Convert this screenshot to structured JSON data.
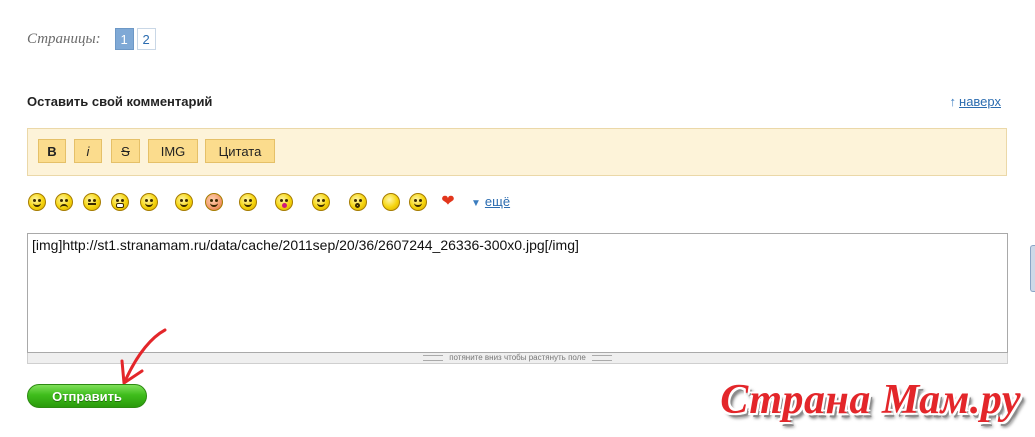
{
  "pager": {
    "label": "Страницы:",
    "pages": [
      "1",
      "2"
    ],
    "current": "1"
  },
  "comment": {
    "title": "Оставить свой комментарий",
    "to_top_label": "наверх"
  },
  "toolbar": {
    "bold": "B",
    "italic": "i",
    "strike": "S",
    "img": "IMG",
    "quote": "Цитата"
  },
  "smiles": {
    "icons": [
      "smile-icon",
      "sad-icon",
      "confused-icon",
      "grin-icon",
      "thumbs-up-icon",
      "wink-icon",
      "blush-icon",
      "girl-icon",
      "kiss-icon",
      "dance-icon",
      "surprised-icon",
      "plain-smiley-icon",
      "lollipop-icon",
      "heart-icon"
    ],
    "more_label": "ещё"
  },
  "editor": {
    "value": "[img]http://st1.stranamam.ru/data/cache/2011sep/20/36/2607244_26336-300x0.jpg[/img]",
    "resize_hint": "потяните вниз чтобы растянуть поле"
  },
  "submit_label": "Отправить",
  "logo_text": "Страна Мам.ру",
  "colors": {
    "link": "#2b6cb0",
    "toolbar_bg": "#fdf3d9",
    "toolbar_button": "#fbdc8d",
    "submit": "#3fbd1c",
    "logo": "#e3262a",
    "annotation_arrow": "#e3262a"
  }
}
